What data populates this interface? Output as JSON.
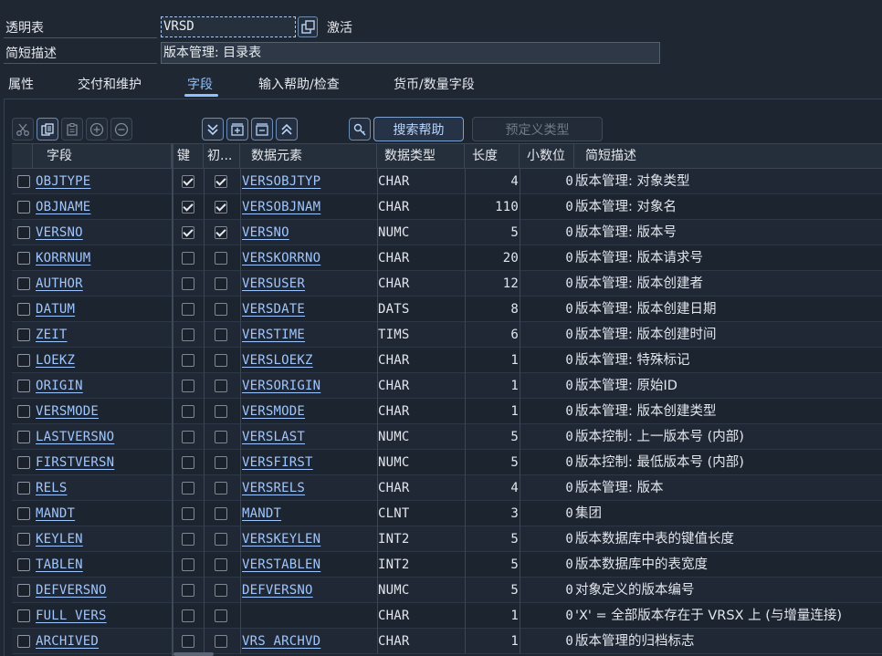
{
  "header": {
    "table_label": "透明表",
    "table_name": "VRSD",
    "status": "激活",
    "desc_label": "简短描述",
    "desc_value": "版本管理: 目录表"
  },
  "tabs": [
    {
      "label": "属性"
    },
    {
      "label": "交付和维护"
    },
    {
      "label": "字段",
      "active": true
    },
    {
      "label": "输入帮助/检查"
    },
    {
      "label": "货币/数量字段"
    }
  ],
  "toolbar": {
    "icons": [
      "cut-icon",
      "copy-icon",
      "paste-icon",
      "add-icon",
      "remove-icon",
      "expand-all-icon",
      "insert-row-icon",
      "delete-row-icon",
      "collapse-all-icon",
      "key-icon"
    ],
    "search_help_label": "搜索帮助",
    "predefined_type_label": "预定义类型"
  },
  "columns": {
    "field": "字段",
    "key": "键",
    "init": "初...",
    "data_element": "数据元素",
    "data_type": "数据类型",
    "length": "长度",
    "decimals": "小数位",
    "short_desc": "简短描述"
  },
  "rows": [
    {
      "field": "OBJTYPE",
      "key": true,
      "init": true,
      "data_element": "VERSOBJTYP",
      "data_type": "CHAR",
      "length": "4",
      "decimals": "0",
      "desc": "版本管理: 对象类型"
    },
    {
      "field": "OBJNAME",
      "key": true,
      "init": true,
      "data_element": "VERSOBJNAM",
      "data_type": "CHAR",
      "length": "110",
      "decimals": "0",
      "desc": "版本管理: 对象名"
    },
    {
      "field": "VERSNO",
      "key": true,
      "init": true,
      "data_element": "VERSNO",
      "data_type": "NUMC",
      "length": "5",
      "decimals": "0",
      "desc": "版本管理: 版本号"
    },
    {
      "field": "KORRNUM",
      "key": false,
      "init": false,
      "data_element": "VERSKORRNO",
      "data_type": "CHAR",
      "length": "20",
      "decimals": "0",
      "desc": "版本管理: 版本请求号"
    },
    {
      "field": "AUTHOR",
      "key": false,
      "init": false,
      "data_element": "VERSUSER",
      "data_type": "CHAR",
      "length": "12",
      "decimals": "0",
      "desc": "版本管理: 版本创建者"
    },
    {
      "field": "DATUM",
      "key": false,
      "init": false,
      "data_element": "VERSDATE",
      "data_type": "DATS",
      "length": "8",
      "decimals": "0",
      "desc": "版本管理: 版本创建日期"
    },
    {
      "field": "ZEIT",
      "key": false,
      "init": false,
      "data_element": "VERSTIME",
      "data_type": "TIMS",
      "length": "6",
      "decimals": "0",
      "desc": "版本管理: 版本创建时间"
    },
    {
      "field": "LOEKZ",
      "key": false,
      "init": false,
      "data_element": "VERSLOEKZ",
      "data_type": "CHAR",
      "length": "1",
      "decimals": "0",
      "desc": "版本管理: 特殊标记"
    },
    {
      "field": "ORIGIN",
      "key": false,
      "init": false,
      "data_element": "VERSORIGIN",
      "data_type": "CHAR",
      "length": "1",
      "decimals": "0",
      "desc": "版本管理: 原始ID"
    },
    {
      "field": "VERSMODE",
      "key": false,
      "init": false,
      "data_element": "VERSMODE",
      "data_type": "CHAR",
      "length": "1",
      "decimals": "0",
      "desc": "版本管理: 版本创建类型"
    },
    {
      "field": "LASTVERSNO",
      "key": false,
      "init": false,
      "data_element": "VERSLAST",
      "data_type": "NUMC",
      "length": "5",
      "decimals": "0",
      "desc": "版本控制: 上一版本号 (内部)"
    },
    {
      "field": "FIRSTVERSN",
      "key": false,
      "init": false,
      "data_element": "VERSFIRST",
      "data_type": "NUMC",
      "length": "5",
      "decimals": "0",
      "desc": "版本控制: 最低版本号 (内部)"
    },
    {
      "field": "RELS",
      "key": false,
      "init": false,
      "data_element": "VERSRELS",
      "data_type": "CHAR",
      "length": "4",
      "decimals": "0",
      "desc": "版本管理: 版本"
    },
    {
      "field": "MANDT",
      "key": false,
      "init": false,
      "data_element": "MANDT",
      "data_type": "CLNT",
      "length": "3",
      "decimals": "0",
      "desc": "集团"
    },
    {
      "field": "KEYLEN",
      "key": false,
      "init": false,
      "data_element": "VERSKEYLEN",
      "data_type": "INT2",
      "length": "5",
      "decimals": "0",
      "desc": "版本数据库中表的键值长度"
    },
    {
      "field": "TABLEN",
      "key": false,
      "init": false,
      "data_element": "VERSTABLEN",
      "data_type": "INT2",
      "length": "5",
      "decimals": "0",
      "desc": "版本数据库中的表宽度"
    },
    {
      "field": "DEFVERSNO",
      "key": false,
      "init": false,
      "data_element": "DEFVERSNO",
      "data_type": "NUMC",
      "length": "5",
      "decimals": "0",
      "desc": "对象定义的版本编号"
    },
    {
      "field": "FULL_VERS",
      "key": false,
      "init": false,
      "data_element": "",
      "data_type": "CHAR",
      "length": "1",
      "decimals": "0",
      "desc": "'X' = 全部版本存在于 VRSX 上 (与增量连接)"
    },
    {
      "field": "ARCHIVED",
      "key": false,
      "init": false,
      "data_element": "VRS_ARCHVD",
      "data_type": "CHAR",
      "length": "1",
      "decimals": "0",
      "desc": "版本管理的归档标志"
    }
  ]
}
